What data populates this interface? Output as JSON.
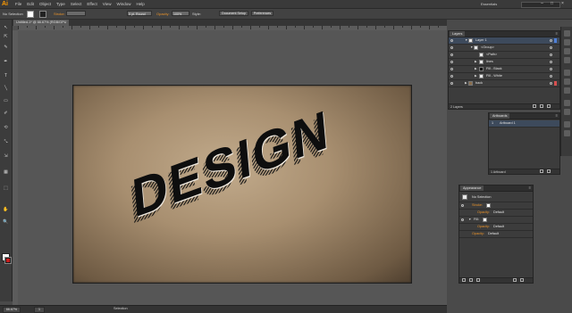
{
  "app": {
    "logo": "Ai",
    "menu": [
      "File",
      "Edit",
      "Object",
      "Type",
      "Select",
      "Effect",
      "View",
      "Window",
      "Help"
    ],
    "workspace": "Essentials",
    "window_controls": [
      "–",
      "□",
      "×"
    ]
  },
  "control_bar": {
    "selection_label": "No Selection",
    "stroke_label": "Stroke:",
    "brush_value": "5 pt. Round",
    "opacity_label": "Opacity:",
    "opacity_value": "100%",
    "style_label": "Style:",
    "document_setup": "Document Setup",
    "preferences": "Preferences"
  },
  "document": {
    "tab_title": "Untitled-1* @ 66.67% (RGB/GPU Preview)",
    "tab_close": "×",
    "zoom": "66.67%",
    "status_tool": "Selection",
    "page_number": "1"
  },
  "artwork": {
    "text": "DESIGN",
    "colors": {
      "bg_center": "#c2ab8c",
      "bg_edge": "#4e3f2f",
      "letter": "#0e0e0e",
      "stripe": "#1a1a1a"
    }
  },
  "layers_panel": {
    "tab": "Layers",
    "menu_icon": "≡",
    "rows": [
      {
        "name": "Layer 1",
        "indent": 0,
        "selected": true
      },
      {
        "name": "<Group>",
        "indent": 1,
        "selected": false
      },
      {
        "name": "<Path>",
        "indent": 2,
        "selected": false
      },
      {
        "name": "lines",
        "indent": 2,
        "selected": false
      },
      {
        "name": "Fill - Black",
        "indent": 2,
        "selected": false
      },
      {
        "name": "Fill - White",
        "indent": 2,
        "selected": false
      },
      {
        "name": "back",
        "indent": 0,
        "selected": false
      }
    ],
    "footer": "2 Layers"
  },
  "artboards_panel": {
    "tab": "Artboards",
    "menu_icon": "≡",
    "row_index": "1",
    "row_name": "Artboard 1",
    "footer": "1 Artboard"
  },
  "appearance_panel": {
    "tab": "Appearance",
    "menu_icon": "≡",
    "selection": "No Selection",
    "stroke_label": "Stroke:",
    "fill_label": "Fill:",
    "opacity_label": "Opacity:",
    "opacity_value": "Default"
  },
  "tools": [
    "↖",
    "⇱",
    "✎",
    "✒",
    "T",
    "╲",
    "▭",
    "✐",
    "⟲",
    "⤡",
    "⇲",
    "▦",
    "⬚",
    "✋",
    "🔍"
  ]
}
